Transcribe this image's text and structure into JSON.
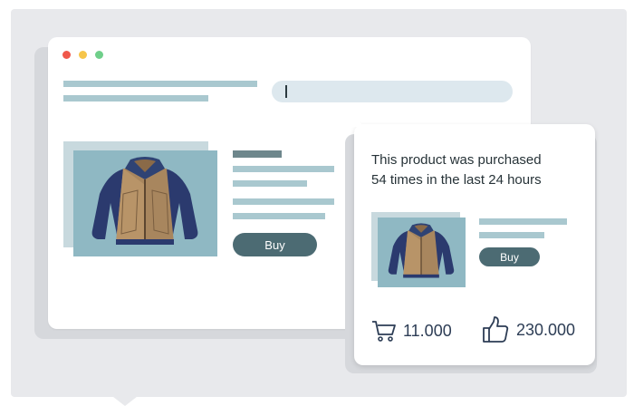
{
  "browser": {
    "window_controls": [
      "close-dot",
      "minimize-dot",
      "maximize-dot"
    ],
    "colors": {
      "close": "#f0584b",
      "minimize": "#f6c54a",
      "maximize": "#6fcf8a"
    }
  },
  "product": {
    "buy_label": "Buy",
    "image_icon": "jacket-icon"
  },
  "popup": {
    "message_line1": "This product was purchased",
    "message_line2": "54 times in the last 24 hours",
    "buy_label": "Buy",
    "cart_count": "11.000",
    "likes_count": "230.000",
    "cart_icon": "cart-icon",
    "like_icon": "thumbs-up-icon"
  }
}
